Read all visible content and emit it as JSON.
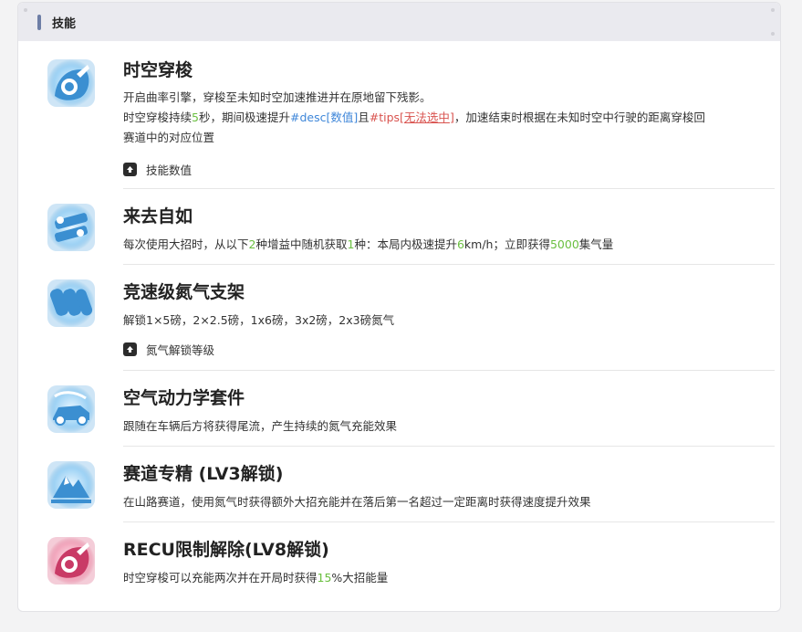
{
  "section": {
    "title": "技能"
  },
  "skills": [
    {
      "name": "时空穿梭",
      "desc1": "开启曲率引擎，穿梭至未知时空加速推进并在原地留下残影。",
      "desc2_a": "时空穿梭持续",
      "desc2_num": "5",
      "desc2_b": "秒，期间极速提升",
      "desc2_tag1": "#desc[数值]",
      "desc2_c": "且",
      "desc2_tag2": "#tips[",
      "desc2_link": "无法选中",
      "desc2_tag3": "]",
      "desc2_d": "，加速结束时根据在未知时空中行驶的距离穿梭回",
      "desc3": "赛道中的对应位置",
      "expand_label": "技能数值",
      "icon": "warp-drive-icon"
    },
    {
      "name": "来去自如",
      "d_a": "每次使用大招时，从以下",
      "d_n1": "2",
      "d_b": "种增益中随机获取",
      "d_n2": "1",
      "d_c": "种：本局内极速提升",
      "d_n3": "6",
      "d_d": "km/h；立即获得",
      "d_n4": "5000",
      "d_e": "集气量",
      "icon": "engine-parts-icon"
    },
    {
      "name": "竞速级氮气支架",
      "desc": "解锁1×5磅，2×2.5磅，1x6磅，3x2磅，2x3磅氮气",
      "expand_label": "氮气解锁等级",
      "icon": "nitro-tanks-icon"
    },
    {
      "name": "空气动力学套件",
      "desc": "跟随在车辆后方将获得尾流，产生持续的氮气充能效果",
      "icon": "aero-kit-icon"
    },
    {
      "name": "赛道专精 (LV3解锁)",
      "desc": "在山路赛道，使用氮气时获得额外大招充能并在落后第一名超过一定距离时获得速度提升效果",
      "icon": "mountain-icon"
    },
    {
      "name": "RECU限制解除(LV8解锁)",
      "d_a": "时空穿梭可以充能两次并在开局时获得",
      "d_n": "15",
      "d_b": "%大招能量",
      "icon": "recu-unlock-icon"
    }
  ],
  "colors": {
    "accent_blue": "#3e86d9",
    "number_green": "#6abf40",
    "tips_red": "#d9534f"
  }
}
